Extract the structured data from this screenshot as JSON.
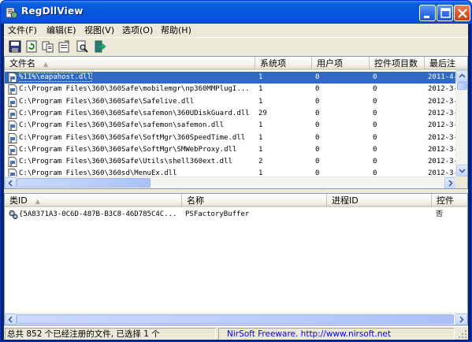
{
  "window": {
    "title": "RegDllView"
  },
  "menu": [
    "文件(F)",
    "编辑(E)",
    "视图(V)",
    "选项(O)",
    "帮助(H)"
  ],
  "toolbar": [
    "save-icon",
    "refresh-icon",
    "copy-icon",
    "properties-icon",
    "find-icon",
    "exit-icon"
  ],
  "top_list": {
    "columns": [
      "文件名",
      "系统项",
      "用户项",
      "控件项目数",
      "最后注"
    ],
    "rows": [
      {
        "file": "%11%\\eapahost.dll",
        "sys": "1",
        "user": "0",
        "ctrl": "0",
        "date": "2011-4-",
        "selected": true
      },
      {
        "file": "C:\\Program Files\\360\\360Safe\\mobilemgr\\np360MMPlugI...",
        "sys": "1",
        "user": "0",
        "ctrl": "0",
        "date": "2012-3-"
      },
      {
        "file": "C:\\Program Files\\360\\360Safe\\Safelive.dll",
        "sys": "1",
        "user": "0",
        "ctrl": "0",
        "date": "2012-3-"
      },
      {
        "file": "C:\\Program Files\\360\\360Safe\\safemon\\360UDiskGuard.dll",
        "sys": "29",
        "user": "0",
        "ctrl": "0",
        "date": "2012-3-"
      },
      {
        "file": "C:\\Program Files\\360\\360Safe\\safemon\\safemon.dll",
        "sys": "1",
        "user": "0",
        "ctrl": "0",
        "date": "2012-3-"
      },
      {
        "file": "C:\\Program Files\\360\\360Safe\\SoftMgr\\360SpeedTime.dll",
        "sys": "1",
        "user": "0",
        "ctrl": "0",
        "date": "2012-3-"
      },
      {
        "file": "C:\\Program Files\\360\\360Safe\\SoftMgr\\SMWebProxy.dll",
        "sys": "1",
        "user": "0",
        "ctrl": "0",
        "date": "2012-3-"
      },
      {
        "file": "C:\\Program Files\\360\\360Safe\\Utils\\shell360ext.dll",
        "sys": "2",
        "user": "0",
        "ctrl": "0",
        "date": "2012-3-"
      },
      {
        "file": "C:\\Program Files\\360\\360sd\\MenuEx.dll",
        "sys": "1",
        "user": "0",
        "ctrl": "0",
        "date": "2012-3-"
      }
    ]
  },
  "bottom_list": {
    "columns": [
      "类ID",
      "名称",
      "进程ID",
      "控件"
    ],
    "rows": [
      {
        "clsid": "{5A8371A3-0C6D-487B-B3C8-46D785C4C...",
        "name": "PSFactoryBuffer",
        "pid": "",
        "ctrl": "否"
      }
    ]
  },
  "status": {
    "left": "总共 852 个已经注册的文件, 已选择 1 个",
    "right": "NirSoft Freeware.  http://www.nirsoft.net"
  },
  "colors": {
    "selection": "#316ac5",
    "title_bar": "#0556e0",
    "status_link": "#0000ff"
  }
}
